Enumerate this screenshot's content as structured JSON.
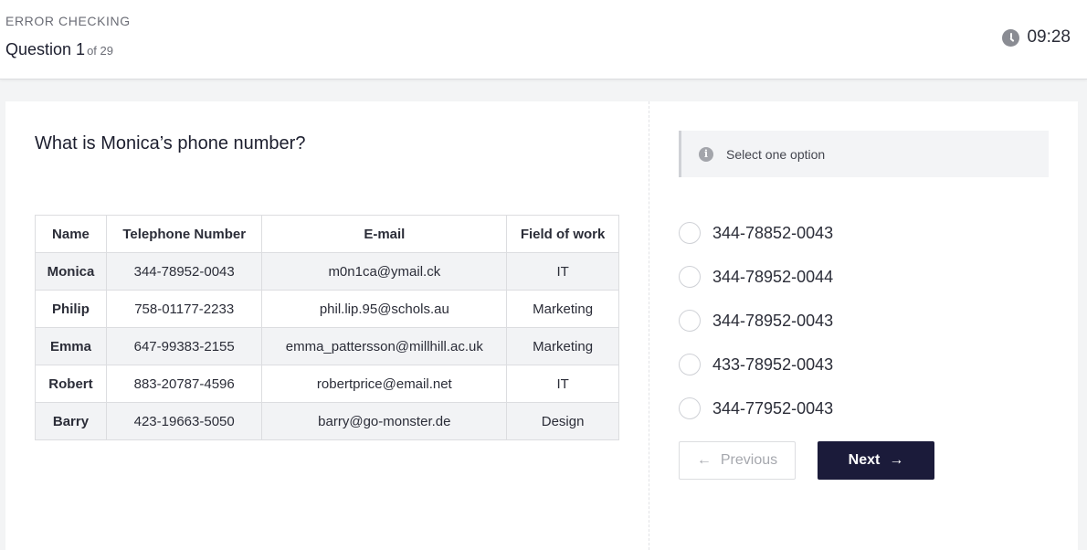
{
  "header": {
    "section_label": "ERROR CHECKING",
    "question_prefix": "Question 1",
    "question_of": "of 29",
    "timer": "09:28",
    "timer_icon": "clock-icon"
  },
  "question": {
    "text": "What is Monica’s phone number?"
  },
  "table": {
    "headers": [
      "Name",
      "Telephone Number",
      "E-mail",
      "Field of work"
    ],
    "rows": [
      [
        "Monica",
        "344-78952-0043",
        "m0n1ca@ymail.ck",
        "IT"
      ],
      [
        "Philip",
        "758-01177-2233",
        "phil.lip.95@schols.au",
        "Marketing"
      ],
      [
        "Emma",
        "647-99383-2155",
        "emma_pattersson@millhill.ac.uk",
        "Marketing"
      ],
      [
        "Robert",
        "883-20787-4596",
        "robertprice@email.net",
        "IT"
      ],
      [
        "Barry",
        "423-19663-5050",
        "barry@go-monster.de",
        "Design"
      ]
    ]
  },
  "hint": {
    "icon": "info-icon",
    "text": "Select one option"
  },
  "options": [
    "344-78852-0043",
    "344-78952-0044",
    "344-78952-0043",
    "433-78952-0043",
    "344-77952-0043"
  ],
  "buttons": {
    "previous": "Previous",
    "next": "Next",
    "previous_arrow": "←",
    "next_arrow": "→"
  },
  "colors": {
    "primary_button": "#1b1b3a",
    "page_background": "#f3f4f5"
  }
}
